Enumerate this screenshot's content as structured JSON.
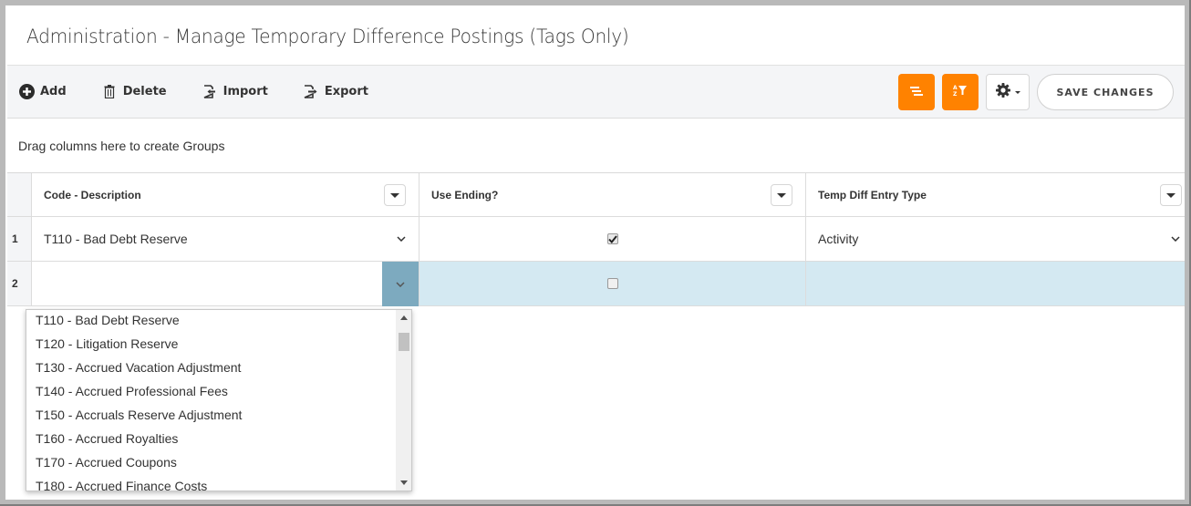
{
  "page": {
    "title": "Administration - Manage Temporary Difference Postings (Tags Only)"
  },
  "toolbar": {
    "add_label": "Add",
    "delete_label": "Delete",
    "import_label": "Import",
    "export_label": "Export",
    "save_label": "SAVE CHANGES",
    "accent_color": "#ff8200",
    "icons": {
      "add": "plus-circle-icon",
      "delete": "trash-icon",
      "import": "import-icon",
      "export": "export-icon",
      "group": "group-lines-icon",
      "sort_filter": "sort-az-filter-icon",
      "settings": "gear-icon"
    }
  },
  "grid": {
    "group_panel_text": "Drag columns here to create Groups",
    "columns": [
      {
        "label": "Code - Description"
      },
      {
        "label": "Use Ending?"
      },
      {
        "label": "Temp Diff Entry Type"
      }
    ],
    "rows": [
      {
        "num": "1",
        "code_description": "T110 - Bad Debt Reserve",
        "use_ending": true,
        "entry_type": "Activity"
      },
      {
        "num": "2",
        "code_description": "",
        "use_ending": false,
        "entry_type": ""
      }
    ],
    "selected_row_color": "#d4e9f2"
  },
  "dropdown": {
    "options": [
      "T110 - Bad Debt Reserve",
      "T120 - Litigation Reserve",
      "T130 - Accrued Vacation Adjustment",
      "T140 - Accrued Professional Fees",
      "T150 - Accruals Reserve Adjustment",
      "T160 - Accrued Royalties",
      "T170 - Accrued Coupons",
      "T180 - Accrued Finance Costs"
    ]
  }
}
